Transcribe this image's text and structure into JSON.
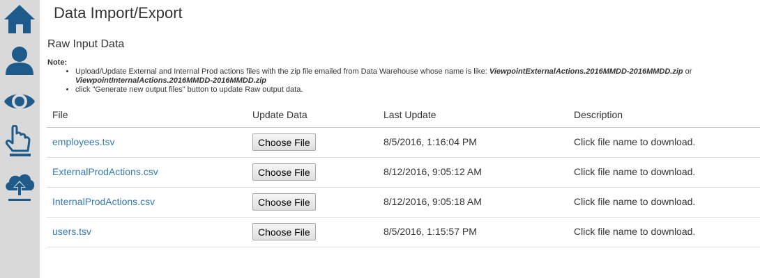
{
  "sidebar": {
    "items": [
      {
        "icon": "home-icon"
      },
      {
        "icon": "user-icon"
      },
      {
        "icon": "eye-icon"
      },
      {
        "icon": "pointer-hand-icon"
      },
      {
        "icon": "cloud-upload-icon"
      }
    ],
    "colors": {
      "background": "#d9d9d9",
      "icon": "#1f5b8a"
    }
  },
  "page": {
    "title": "Data Import/Export"
  },
  "section": {
    "title": "Raw Input Data",
    "note_label": "Note:",
    "note_line1_prefix": "Upload/Update External and Internal Prod actions files with the zip file emailed from Data Warehouse whose name is like: ",
    "note_line1_file1": "ViewpointExternalActions.2016MMDD-2016MMDD.zip",
    "note_line1_or": " or ",
    "note_line1_file2": "ViewpointInternalActions.2016MMDD-2016MMDD.zip",
    "note_line2": "click \"Generate new output files\" button to update Raw output data."
  },
  "table": {
    "headers": {
      "file": "File",
      "update": "Update Data",
      "last": "Last Update",
      "desc": "Description"
    },
    "rows": [
      {
        "file": "employees.tsv",
        "button": "Choose File",
        "last_update": "8/5/2016, 1:16:04 PM",
        "description": "Click file name to download."
      },
      {
        "file": "ExternalProdActions.csv",
        "button": "Choose File",
        "last_update": "8/12/2016, 9:05:12 AM",
        "description": "Click file name to download."
      },
      {
        "file": "InternalProdActions.csv",
        "button": "Choose File",
        "last_update": "8/12/2016, 9:05:18 AM",
        "description": "Click file name to download."
      },
      {
        "file": "users.tsv",
        "button": "Choose File",
        "last_update": "8/5/2016, 1:15:57 PM",
        "description": "Click file name to download."
      }
    ],
    "link_color": "#337ab7"
  }
}
